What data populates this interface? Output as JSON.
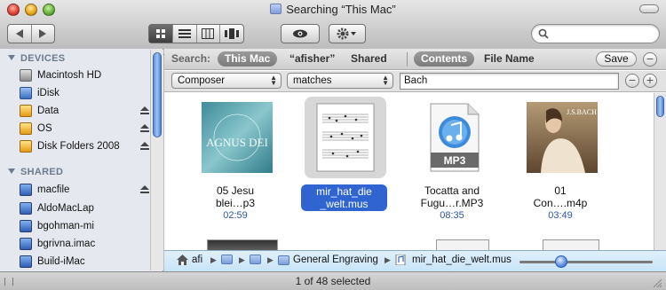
{
  "window": {
    "title": "Searching “This Mac”"
  },
  "toolbar": {
    "nav": [
      "back",
      "forward"
    ],
    "views": [
      "icon-view",
      "list-view",
      "column-view",
      "cover-flow-view"
    ],
    "quicklook_icon": "eye-icon",
    "action_icon": "gear-icon",
    "search": {
      "value": "",
      "placeholder": ""
    }
  },
  "sidebar": {
    "devices_header": "DEVICES",
    "devices": [
      {
        "label": "Macintosh HD",
        "icon": "hard-drive-icon",
        "eject": false
      },
      {
        "label": "iDisk",
        "icon": "idisk-icon",
        "eject": false
      },
      {
        "label": "Data",
        "icon": "volume-icon",
        "eject": true
      },
      {
        "label": "OS",
        "icon": "volume-icon",
        "eject": true
      },
      {
        "label": "Disk Folders 2008",
        "icon": "volume-icon",
        "eject": true
      }
    ],
    "shared_header": "SHARED",
    "shared": [
      {
        "label": "macfile",
        "icon": "network-mac-icon",
        "eject": true
      },
      {
        "label": "AldoMacLap",
        "icon": "network-mac-icon",
        "eject": false
      },
      {
        "label": "bgohman-mi",
        "icon": "network-mac-icon",
        "eject": false
      },
      {
        "label": "bgrivna.imac",
        "icon": "network-mac-icon",
        "eject": false
      },
      {
        "label": "Build-iMac",
        "icon": "network-mac-icon",
        "eject": false
      }
    ]
  },
  "searchbar": {
    "label": "Search:",
    "scopes": [
      "This Mac",
      "“afisher”",
      "Shared"
    ],
    "active_scope": "This Mac",
    "targets": [
      "Contents",
      "File Name"
    ],
    "active_target": "Contents",
    "save_label": "Save",
    "remove_label": "−",
    "add_label": "+"
  },
  "criteria": {
    "attribute": "Composer",
    "operator": "matches",
    "value": "Bach"
  },
  "results": [
    {
      "name_line1": "05 Jesu",
      "name_line2": "blei…p3",
      "duration": "02:59",
      "art_text": "AGNUS DEI",
      "selected": false
    },
    {
      "name_line1": "mir_hat_die",
      "name_line2": "_welt.mus",
      "duration": "",
      "art_text": "",
      "selected": true
    },
    {
      "name_line1": "Tocatta and",
      "name_line2": "Fugu…r.MP3",
      "duration": "08:35",
      "art_text": "MP3",
      "selected": false
    },
    {
      "name_line1": "01",
      "name_line2": "Con….m4p",
      "duration": "03:49",
      "art_text": "J.S.BACH",
      "selected": false
    }
  ],
  "pathbar": {
    "items": [
      {
        "label": "afi",
        "icon": "home-icon"
      },
      {
        "label": "",
        "icon": "folder-icon"
      },
      {
        "label": "",
        "icon": "folder-icon"
      },
      {
        "label": "General Engraving",
        "icon": "folder-icon"
      },
      {
        "label": "mir_hat_die_welt.mus",
        "icon": "music-document-icon"
      }
    ],
    "zoom_level": 0.3
  },
  "status": {
    "text": "1 of 48 selected"
  },
  "colors": {
    "selection": "#2f64d1",
    "accent": "#5d8fe0"
  }
}
